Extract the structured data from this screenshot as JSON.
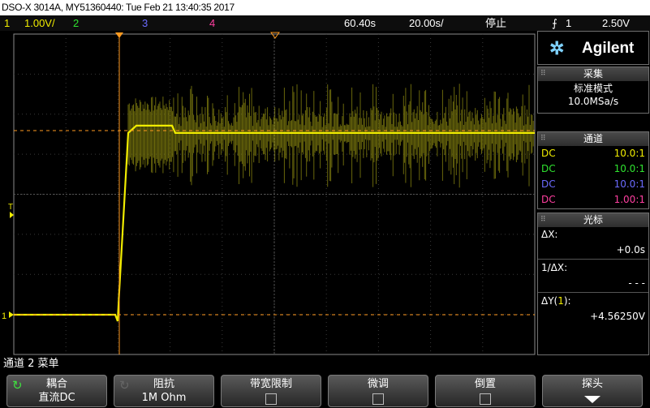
{
  "window": {
    "title": "DSO-X 3014A, MY51360440: Tue Feb 21 13:40:35 2017"
  },
  "status": {
    "ch1_num": "1",
    "ch1_scale": "1.00V/",
    "ch2_num": "2",
    "ch3_num": "3",
    "ch4_num": "4",
    "time_offset": "60.40s",
    "time_scale": "20.00s/",
    "run_state": "停止",
    "trig_icon": "trigger-edge-icon",
    "trig_source": "1",
    "trig_level": "2.50V"
  },
  "colors": {
    "ch1": "#f0ec00",
    "ch2": "#2fe22f",
    "ch3": "#6b6bff",
    "ch4": "#ff3fa0",
    "trigger_marker": "#ff9a1f"
  },
  "brand": "Agilent",
  "acquire": {
    "header": "采集",
    "mode": "标准模式",
    "rate": "10.0MSa/s"
  },
  "channels": {
    "header": "通道",
    "items": [
      {
        "coupling": "DC",
        "probe": "10.0:1"
      },
      {
        "coupling": "DC",
        "probe": "10.0:1"
      },
      {
        "coupling": "DC",
        "probe": "10.0:1"
      },
      {
        "coupling": "DC",
        "probe": "1.00:1"
      }
    ]
  },
  "cursor": {
    "header": "光标",
    "dx_label": "ΔX:",
    "dx_value": "+0.0s",
    "inv_dx_label": "1/ΔX:",
    "inv_dx_value": "- - -",
    "dy_label_prefix": "ΔY(",
    "dy_channel": "1",
    "dy_label_suffix": "):",
    "dy_value": "+4.56250V"
  },
  "waveform": {
    "low_level_v": 0.0,
    "high_level_v": 4.5625,
    "scale_v_per_div": 1.0
  },
  "markers": {
    "ground_ref": "1",
    "trigger_level": "T"
  },
  "menu": {
    "title": "通道 2 菜单"
  },
  "softkeys": [
    {
      "title": "耦合",
      "value": "直流DC"
    },
    {
      "title": "阻抗",
      "value": "1M Ohm"
    },
    {
      "title": "带宽限制",
      "value": ""
    },
    {
      "title": "微调",
      "value": ""
    },
    {
      "title": "倒置",
      "value": ""
    },
    {
      "title": "探头",
      "value": ""
    }
  ]
}
